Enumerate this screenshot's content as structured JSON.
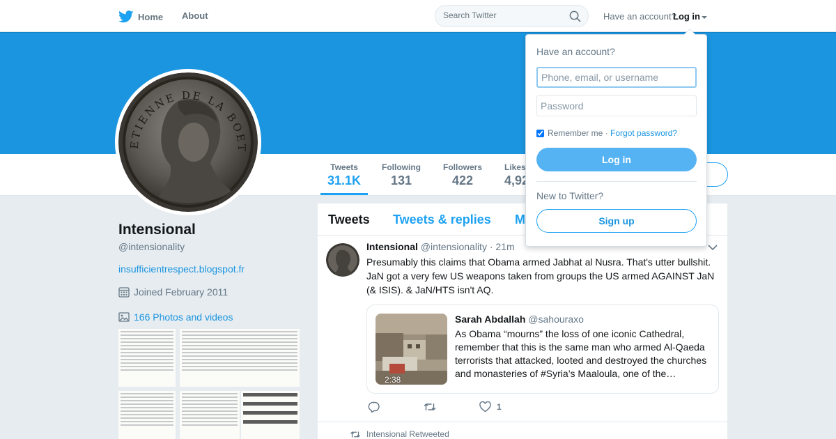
{
  "nav": {
    "home_label": "Home",
    "about_label": "About",
    "search_placeholder": "Search Twitter",
    "have_account": "Have an account?",
    "login_label": "Log in"
  },
  "colors": {
    "brand": "#1da1f2",
    "banner": "#1b95e0",
    "link": "#1b95e0",
    "muted": "#657786"
  },
  "stats": [
    {
      "label": "Tweets",
      "value": "31.1K"
    },
    {
      "label": "Following",
      "value": "131"
    },
    {
      "label": "Followers",
      "value": "422"
    },
    {
      "label": "Likes",
      "value": "4,92"
    }
  ],
  "profile": {
    "name": "Intensional",
    "handle": "@intensionality",
    "url": "insufficientrespect.blogspot.fr",
    "joined": "Joined February 2011",
    "photos": "166 Photos and videos",
    "avatar_inscription": "ETIENNE DE LA BOETIE"
  },
  "timeline": {
    "tabs": [
      "Tweets",
      "Tweets & replies",
      "M"
    ],
    "tweet": {
      "name": "Intensional",
      "handle": "@intensionality",
      "dot": "·",
      "time": "21m",
      "text": "Presumably this claims that Obama armed Jabhat al Nusra.  That's utter bullshit.  JaN got a very few US weapons taken from groups the US armed AGAINST JaN (& ISIS).  & JaN/HTS isn't AQ.",
      "quote": {
        "name": "Sarah Abdallah",
        "handle": "@sahouraxo",
        "duration": "2:38",
        "text": "As Obama “mourns” the loss of one iconic Cathedral, remember that this is the same man who armed Al-Qaeda terrorists that attacked, looted and destroyed the churches and monasteries of #Syria’s Maaloula, one of the…"
      },
      "likes": "1"
    },
    "retweeted_label": "Intensional Retweeted"
  },
  "login_dropdown": {
    "title": "Have an account?",
    "user_placeholder": "Phone, email, or username",
    "password_placeholder": "Password",
    "remember": "Remember me",
    "separator": "·",
    "forgot": "Forgot password?",
    "login_button": "Log in",
    "new_to_twitter": "New to Twitter?",
    "signup_button": "Sign up"
  }
}
